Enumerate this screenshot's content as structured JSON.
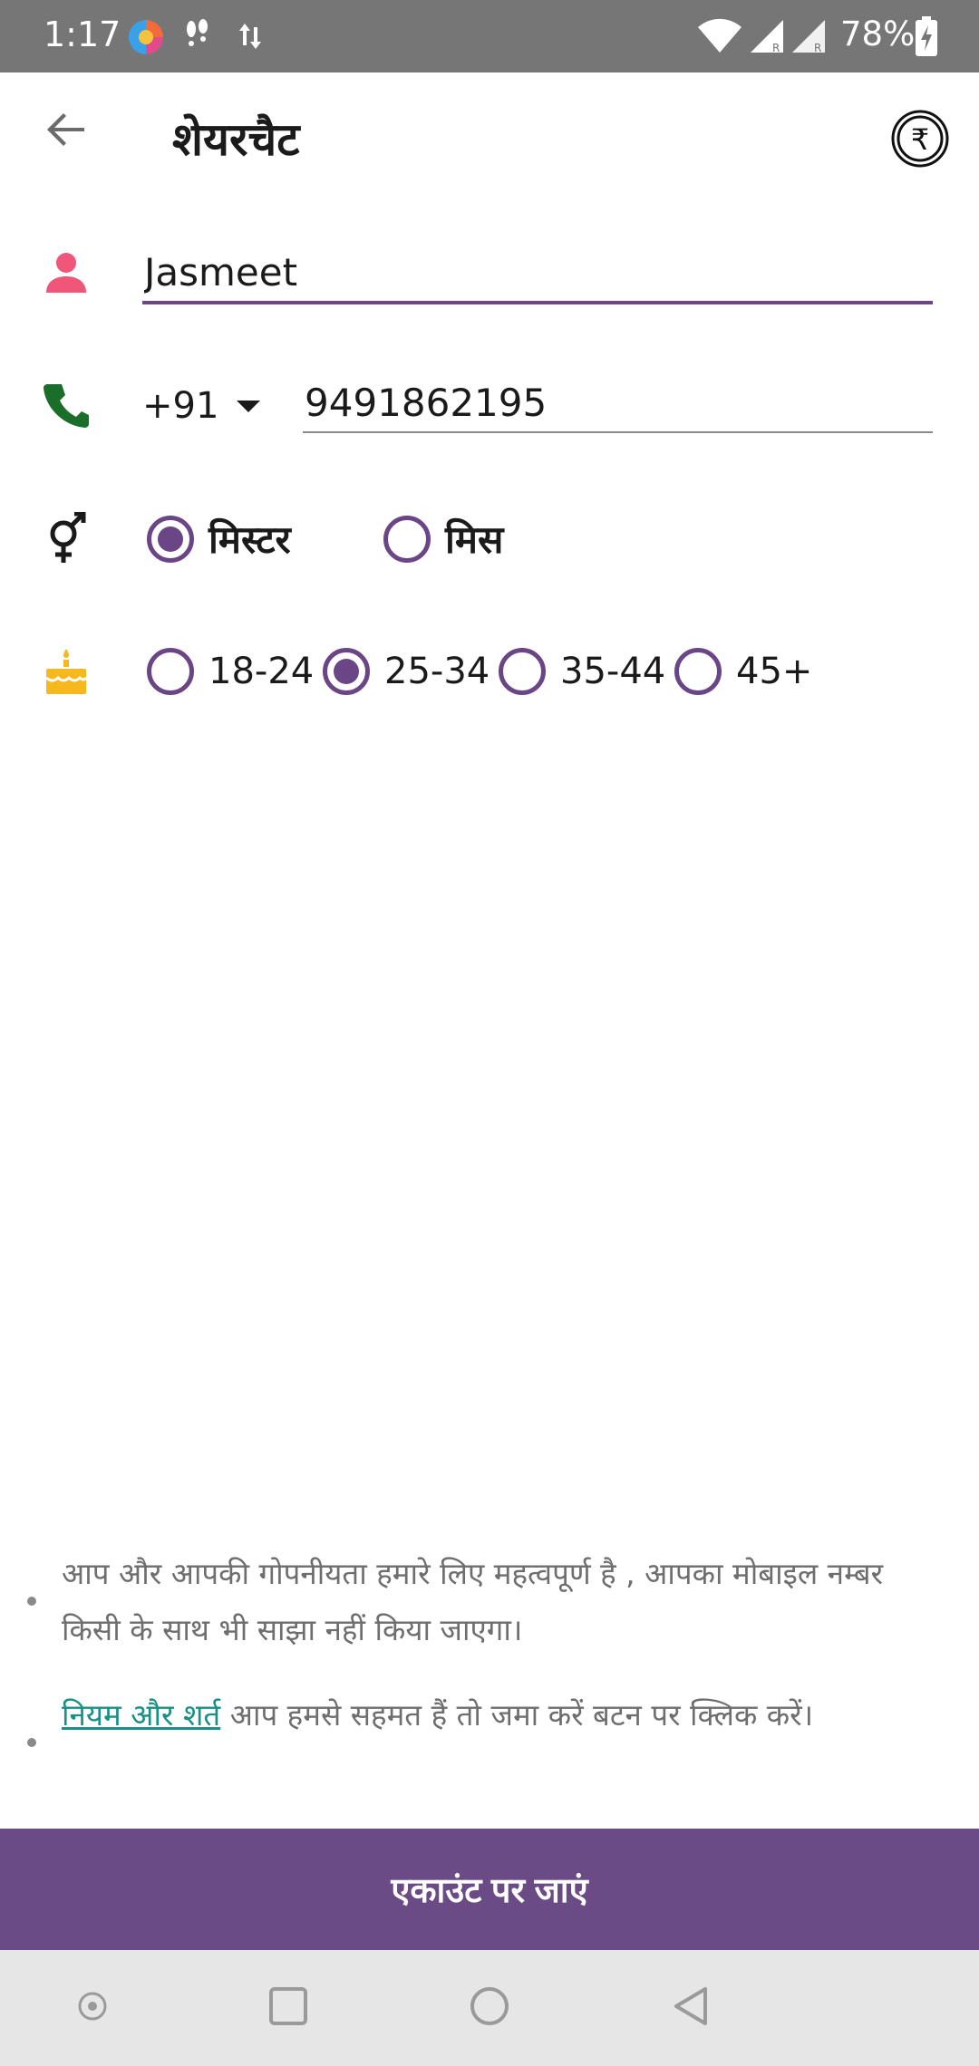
{
  "status_bar": {
    "time": "1:17",
    "battery_percent": "78%",
    "icons": [
      "browser-app-icon",
      "footsteps-icon",
      "data-transfer-icon",
      "wifi-icon",
      "signal-icon",
      "signal-icon",
      "battery-charging-icon"
    ]
  },
  "app_bar": {
    "title": "शेयरचैट",
    "back_icon": "arrow-left-icon",
    "wallet_icon": "rupee-coin-icon"
  },
  "form": {
    "name": {
      "icon": "person-icon",
      "value": "Jasmeet"
    },
    "phone": {
      "icon": "phone-icon",
      "country_code": "+91",
      "value": "9491862195"
    },
    "gender": {
      "icon": "gender-icon",
      "options": [
        {
          "label": "मिस्टर",
          "selected": true
        },
        {
          "label": "मिस",
          "selected": false
        }
      ]
    },
    "age": {
      "icon": "birthday-cake-icon",
      "options": [
        {
          "label": "18-24",
          "selected": false
        },
        {
          "label": "25-34",
          "selected": true
        },
        {
          "label": "35-44",
          "selected": false
        },
        {
          "label": "45+",
          "selected": false
        }
      ]
    }
  },
  "notes": {
    "privacy": "आप और आपकी गोपनीयता हमारे लिए महत्वपूर्ण है , आपका मोबाइल नम्बर किसी के साथ भी साझा नहीं किया जाएगा।",
    "terms_link": "नियम और शर्त",
    "terms_rest": " आप हमसे सहमत हैं तो जमा करें बटन पर क्लिक करें।"
  },
  "submit": {
    "label": "एकाउंट पर जाएं"
  },
  "colors": {
    "accent": "#6a4b85",
    "person_icon": "#f0567a",
    "phone_icon": "#1b6e2a",
    "cake_icon": "#f7b81e",
    "link": "#1a8f84"
  }
}
